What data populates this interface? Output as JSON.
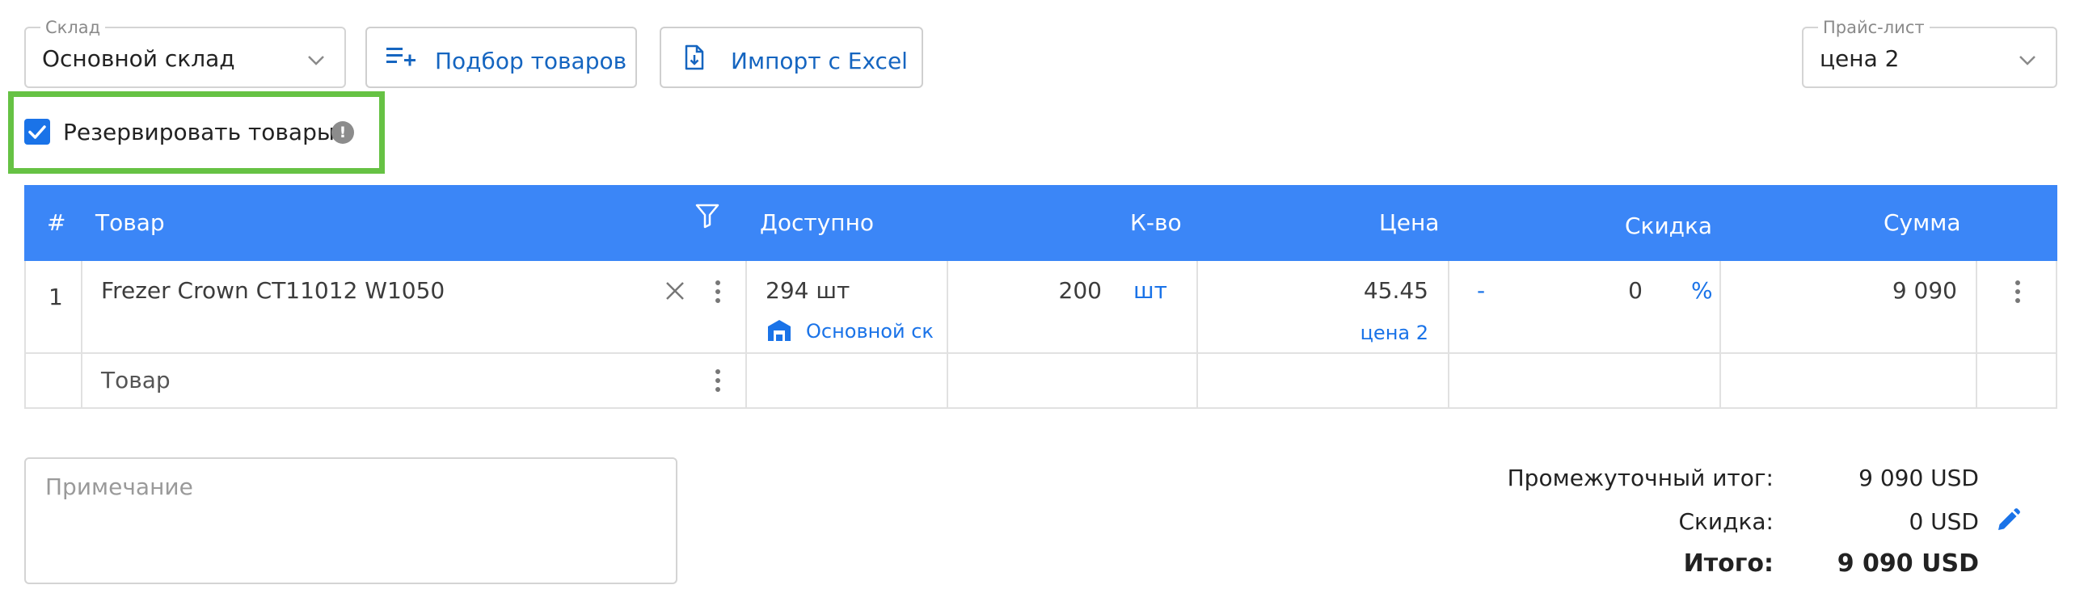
{
  "toolbar": {
    "warehouse_legend": "Склад",
    "warehouse_value": "Основной склад",
    "pick_items_label": "Подбор товаров",
    "import_label": "Импорт с Excel",
    "pricelist_legend": "Прайс-лист",
    "pricelist_value": "цена 2"
  },
  "reserve": {
    "checked": true,
    "label": "Резервировать товары",
    "info_glyph": "!"
  },
  "table": {
    "headers": {
      "num": "#",
      "product": "Товар",
      "available": "Доступно",
      "qty": "К-во",
      "price": "Цена",
      "discount": "Скидка",
      "sum": "Сумма"
    },
    "rows": [
      {
        "num": "1",
        "product": "Frezer Crown CT11012 W1050",
        "available": "294 шт",
        "warehouse": "Основной ск",
        "qty": "200",
        "unit": "шт",
        "price": "45.45",
        "pricelist": "цена 2",
        "discount_sign": "-",
        "discount_value": "0",
        "discount_unit": "%",
        "sum": "9 090"
      }
    ],
    "new_row_placeholder": "Товар"
  },
  "note": {
    "placeholder": "Примечание"
  },
  "totals": {
    "subtotal_label": "Промежуточный итог:",
    "subtotal_value": "9 090 USD",
    "discount_label": "Скидка:",
    "discount_value": "0 USD",
    "total_label": "Итого:",
    "total_value": "9 090 USD"
  },
  "colors": {
    "accent": "#1a73e8",
    "header_bg": "#3b86f7",
    "highlight": "#66c244"
  }
}
